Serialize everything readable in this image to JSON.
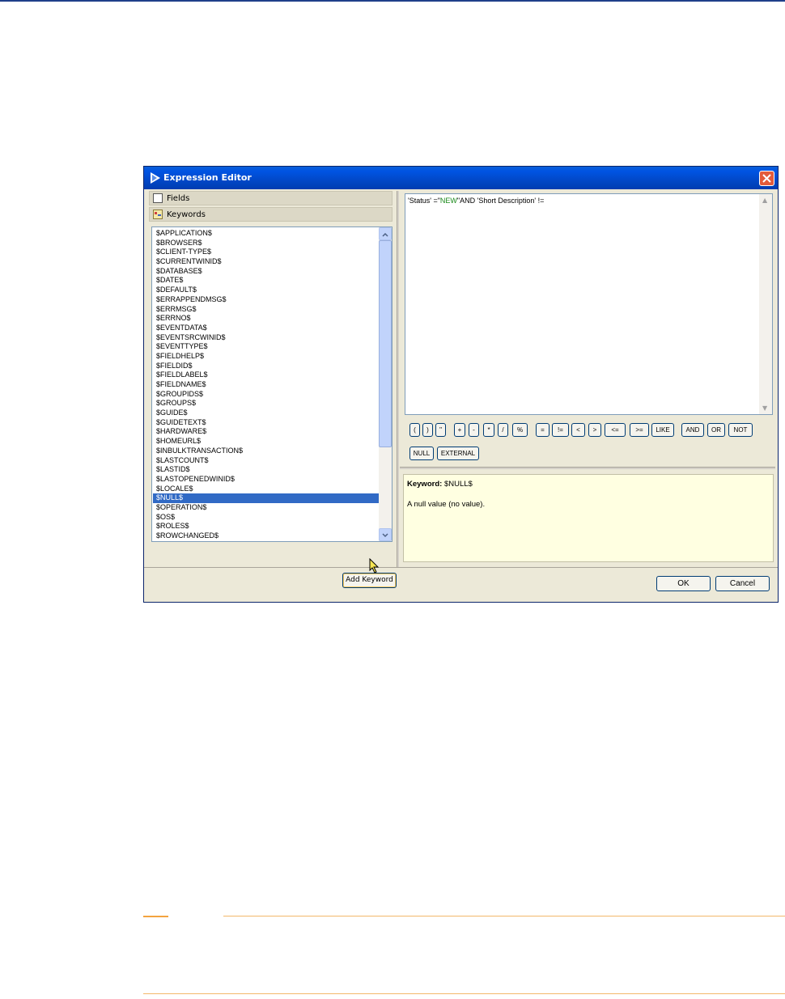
{
  "dialog": {
    "title": "Expression Editor"
  },
  "left_panel": {
    "fields_label": "Fields",
    "keywords_label": "Keywords",
    "keywords": [
      "$APPLICATION$",
      "$BROWSER$",
      "$CLIENT-TYPE$",
      "$CURRENTWINID$",
      "$DATABASE$",
      "$DATE$",
      "$DEFAULT$",
      "$ERRAPPENDMSG$",
      "$ERRMSG$",
      "$ERRNO$",
      "$EVENTDATA$",
      "$EVENTSRCWINID$",
      "$EVENTTYPE$",
      "$FIELDHELP$",
      "$FIELDID$",
      "$FIELDLABEL$",
      "$FIELDNAME$",
      "$GROUPIDS$",
      "$GROUPS$",
      "$GUIDE$",
      "$GUIDETEXT$",
      "$HARDWARE$",
      "$HOMEURL$",
      "$INBULKTRANSACTION$",
      "$LASTCOUNT$",
      "$LASTID$",
      "$LASTOPENEDWINID$",
      "$LOCALE$",
      "$NULL$",
      "$OPERATION$",
      "$OS$",
      "$ROLES$",
      "$ROWCHANGED$"
    ],
    "selected_index": 28,
    "add_keyword_label": "Add Keyword"
  },
  "expression": {
    "part1": "'Status' =\"",
    "part2": "NEW",
    "part3": "\"AND 'Short Description' !="
  },
  "operators_row1": [
    "(",
    ")",
    "\"",
    "+",
    "-",
    "*",
    "/",
    "%",
    "=",
    "!=",
    "<",
    ">",
    "<=",
    ">=",
    "LIKE",
    "AND",
    "OR",
    "NOT"
  ],
  "operators_row2": [
    "NULL",
    "EXTERNAL"
  ],
  "description": {
    "title_label": "Keyword:",
    "title_value": "$NULL$",
    "body": "A null value (no value)."
  },
  "buttons": {
    "ok": "OK",
    "cancel": "Cancel"
  },
  "colors": {
    "title_bar": "#0054e3",
    "selection": "#316ac5",
    "description_bg": "#ffffe1",
    "string_literal": "#1a8a1a",
    "page_rule": "#f3a43f"
  }
}
